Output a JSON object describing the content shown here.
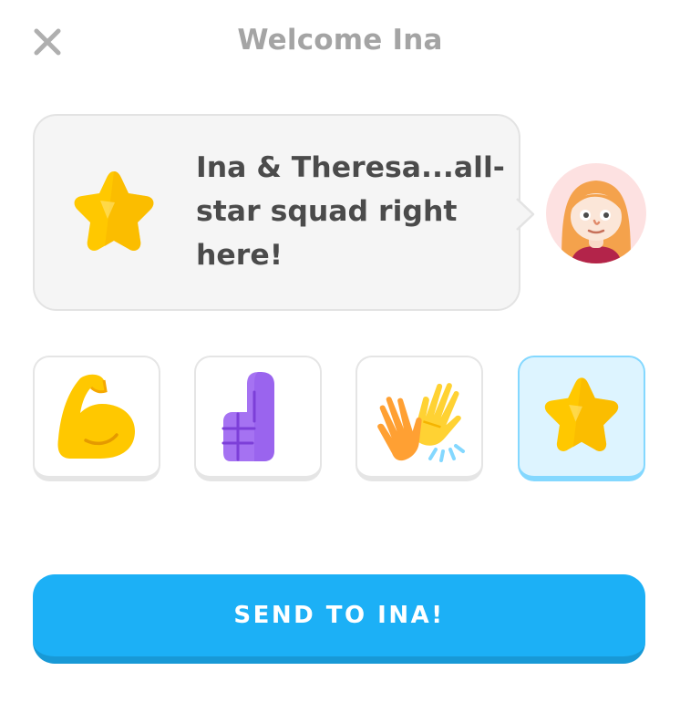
{
  "header": {
    "title": "Welcome Ina",
    "close_icon": "close-icon"
  },
  "message": {
    "icon": "star-icon",
    "text": "Ina & Theresa...all-star squad right here!"
  },
  "avatar": {
    "icon": "character-avatar"
  },
  "choices": [
    {
      "icon": "flexed-bicep-icon",
      "selected": false
    },
    {
      "icon": "number-one-finger-icon",
      "selected": false
    },
    {
      "icon": "high-five-icon",
      "selected": false
    },
    {
      "icon": "star-icon",
      "selected": true
    }
  ],
  "actions": {
    "send_label": "SEND TO INA!"
  },
  "colors": {
    "accent": "#1cb0f6",
    "selected_bg": "#ddf4ff",
    "selected_border": "#84d8ff",
    "star": "#ffc800"
  }
}
